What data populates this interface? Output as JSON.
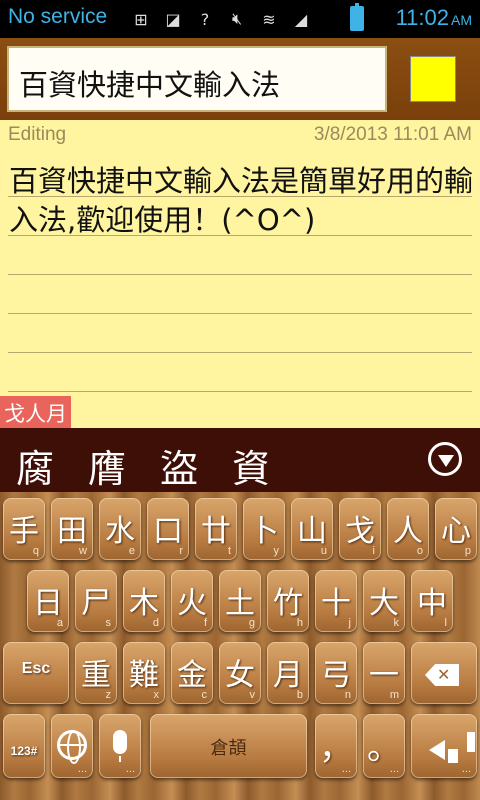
{
  "status_bar": {
    "carrier": "No service",
    "time": "11:02",
    "ampm": "AM",
    "icons": [
      "add-icon",
      "sim-icon",
      "question-icon",
      "mute-icon",
      "wifi-icon",
      "signal-icon",
      "battery-icon"
    ]
  },
  "title_bar": {
    "title": "百資快捷中文輸入法",
    "note_color": "#ffff00"
  },
  "note": {
    "status": "Editing",
    "date": "3/8/2013 11:01 AM",
    "body": "百資快捷中文輸入法是簡單好用的輸入法,歡迎使用！(^O^)",
    "composing": "戈人月",
    "background": "#fff49f"
  },
  "candidates": [
    "腐",
    "膺",
    "盜",
    "資"
  ],
  "keyboard": {
    "row1": [
      {
        "main": "手",
        "sub": "q"
      },
      {
        "main": "田",
        "sub": "w"
      },
      {
        "main": "水",
        "sub": "e"
      },
      {
        "main": "口",
        "sub": "r"
      },
      {
        "main": "廿",
        "sub": "t"
      },
      {
        "main": "卜",
        "sub": "y"
      },
      {
        "main": "山",
        "sub": "u"
      },
      {
        "main": "戈",
        "sub": "i"
      },
      {
        "main": "人",
        "sub": "o"
      },
      {
        "main": "心",
        "sub": "p"
      }
    ],
    "row2": [
      {
        "main": "日",
        "sub": "a"
      },
      {
        "main": "尸",
        "sub": "s"
      },
      {
        "main": "木",
        "sub": "d"
      },
      {
        "main": "火",
        "sub": "f"
      },
      {
        "main": "土",
        "sub": "g"
      },
      {
        "main": "竹",
        "sub": "h"
      },
      {
        "main": "十",
        "sub": "j"
      },
      {
        "main": "大",
        "sub": "k"
      },
      {
        "main": "中",
        "sub": "l"
      }
    ],
    "row3": [
      {
        "main": "重",
        "sub": "z"
      },
      {
        "main": "難",
        "sub": "x"
      },
      {
        "main": "金",
        "sub": "c"
      },
      {
        "main": "女",
        "sub": "v"
      },
      {
        "main": "月",
        "sub": "b"
      },
      {
        "main": "弓",
        "sub": "n"
      },
      {
        "main": "一",
        "sub": "m"
      }
    ],
    "esc": "Esc",
    "numbers": "123#",
    "space": "倉頡",
    "comma": "，",
    "period": "。",
    "ellipsis": "..."
  }
}
